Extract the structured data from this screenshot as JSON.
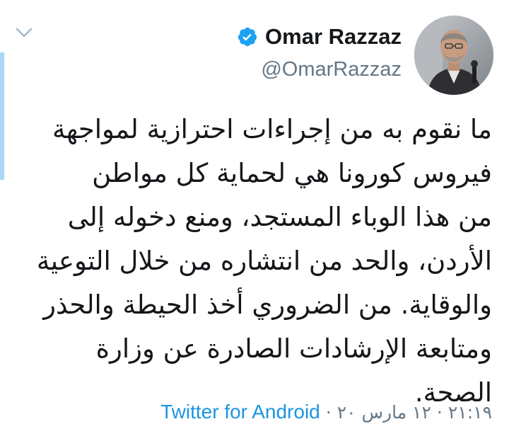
{
  "author": {
    "name": "Omar Razzaz",
    "handle": "@OmarRazzaz",
    "verified": true
  },
  "tweet": {
    "lines": [
      "ما نقوم به من إجراءات احترازية لمواجهة",
      "فيروس كورونا هي لحماية كل مواطن",
      "من هذا الوباء المستجد، ومنع دخوله إلى",
      "الأردن، والحد من انتشاره من خلال التوعية",
      "والوقاية. من الضروري أخذ الحيطة والحذر",
      "ومتابعة الإرشادات الصادرة عن وزارة",
      "الصحة."
    ]
  },
  "meta": {
    "time": "٢١:١٩",
    "separator": "·",
    "date": "١٢ مارس ٢٠",
    "source": "Twitter for Android"
  },
  "icons": {
    "more": "chevron-down-icon",
    "verified": "verified-badge-icon",
    "avatar": "profile-photo"
  },
  "colors": {
    "text": "#14171a",
    "secondary": "#657786",
    "link": "#1b95e0",
    "verified": "#1da1f2",
    "accent_bar": "#a8d8f5"
  }
}
